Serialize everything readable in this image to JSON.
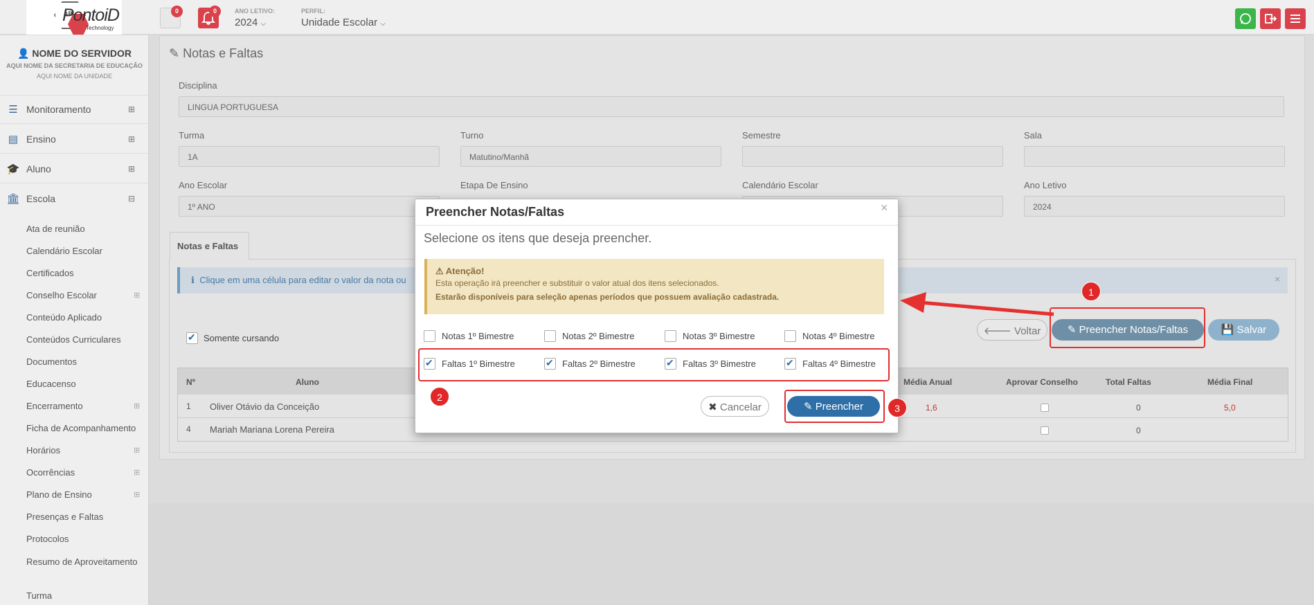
{
  "app": {
    "logo_text": "PontoiD",
    "logo_sub": "Technology",
    "logo_hex": "API"
  },
  "topbar": {
    "messages_count": "0",
    "alerts_count": "0",
    "ano_letivo_label": "ANO LETIVO:",
    "ano_letivo_value": "2024",
    "perfil_label": "PERFIL:",
    "perfil_value": "Unidade Escolar"
  },
  "sidebar": {
    "user_name": "NOME DO SERVIDOR",
    "secretaria": "AQUI NOME DA SECRETARIA DE EDUCAÇÃO",
    "unidade": "AQUI NOME DA UNIDADE",
    "sections": [
      {
        "label": "Monitoramento",
        "icon": "sliders-icon"
      },
      {
        "label": "Ensino",
        "icon": "book-icon"
      },
      {
        "label": "Aluno",
        "icon": "graduation-cap-icon"
      },
      {
        "label": "Escola",
        "icon": "bank-icon"
      }
    ],
    "escola_items": [
      "Ata de reunião",
      "Calendário Escolar",
      "Certificados",
      "Conselho Escolar",
      "Conteúdo Aplicado",
      "Conteúdos Curriculares",
      "Documentos",
      "Educacenso",
      "Encerramento",
      "Ficha de Acompanhamento",
      "Horários",
      "Ocorrências",
      "Plano de Ensino",
      "Presenças e Faltas",
      "Protocolos",
      "Resumo de Aproveitamento",
      "Turma"
    ]
  },
  "page": {
    "title": "Notas e Faltas",
    "disciplina_label": "Disciplina",
    "disciplina_value": "LINGUA PORTUGUESA",
    "turma_label": "Turma",
    "turma_value": "1A",
    "turno_label": "Turno",
    "turno_value": "Matutino/Manhã",
    "semestre_label": "Semestre",
    "semestre_value": "",
    "sala_label": "Sala",
    "sala_value": "",
    "ano_escolar_label": "Ano Escolar",
    "ano_escolar_value": "1º ANO",
    "etapa_label": "Etapa De Ensino",
    "calendario_label": "Calendário Escolar",
    "ano_letivo_label": "Ano Letivo",
    "ano_letivo_value": "2024",
    "tab": "Notas e Faltas",
    "info_text": "Clique em uma célula para editar o valor da nota ou",
    "somente_cursando": "Somente cursando",
    "btn_voltar": "Voltar",
    "btn_preencher": "Preencher Notas/Faltas",
    "btn_salvar": "Salvar",
    "table_headers": {
      "n": "Nº",
      "aluno": "Aluno",
      "media_anual": "Média Anual",
      "aprovar": "Aprovar Conselho",
      "total_faltas": "Total Faltas",
      "media_final": "Média Final"
    },
    "rows": [
      {
        "n": "1",
        "aluno": "Oliver Otávio da Conceição",
        "media_anual": "1,6",
        "total_faltas": "0",
        "media_final": "5,0"
      },
      {
        "n": "4",
        "aluno": "Mariah Mariana Lorena Pereira",
        "media_anual": "",
        "total_faltas": "0",
        "media_final": ""
      }
    ]
  },
  "modal": {
    "title": "Preencher Notas/Faltas",
    "close": "×",
    "subtitle": "Selecione os itens que deseja preencher.",
    "warning_title": "Atenção!",
    "warning_line1": "Esta operação irá preencher e substituir o valor atual dos itens selecionados.",
    "warning_line2": "Estarão disponíveis para seleção apenas períodos que possuem avaliação cadastrada.",
    "notas": [
      {
        "label": "Notas 1º Bimestre",
        "checked": false
      },
      {
        "label": "Notas 2º Bimestre",
        "checked": false
      },
      {
        "label": "Notas 3º Bimestre",
        "checked": false
      },
      {
        "label": "Notas 4º Bimestre",
        "checked": false
      }
    ],
    "faltas": [
      {
        "label": "Faltas 1º Bimestre",
        "checked": true
      },
      {
        "label": "Faltas 2º Bimestre",
        "checked": true
      },
      {
        "label": "Faltas 3º Bimestre",
        "checked": true
      },
      {
        "label": "Faltas 4º Bimestre",
        "checked": true
      }
    ],
    "btn_cancelar": "Cancelar",
    "btn_preencher": "Preencher"
  },
  "annotations": [
    "1",
    "2",
    "3"
  ],
  "colors": {
    "accent": "#2f6fa8",
    "danger": "#d9424b",
    "whatsapp": "#3cb54a",
    "warning_bg": "#f2e6c3"
  }
}
